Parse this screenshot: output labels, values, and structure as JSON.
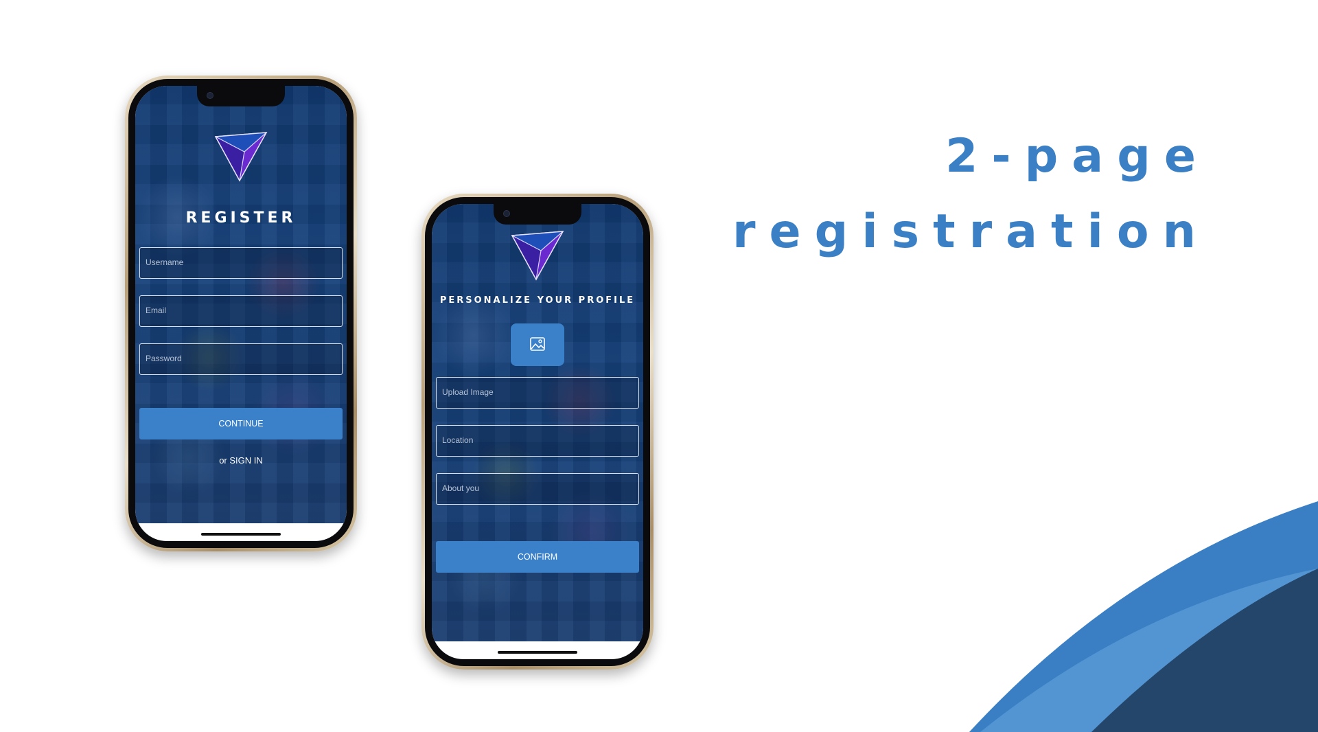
{
  "headline": {
    "line1": "2-page",
    "line2": "registration"
  },
  "colors": {
    "accent": "#3b80c4",
    "button": "#3a81c9",
    "screen_bg": "#153d76",
    "deco_dark": "#24466a",
    "deco_light": "#5396d3"
  },
  "phone1": {
    "logo_icon": "triangle-gem-logo",
    "title": "REGISTER",
    "fields": [
      {
        "placeholder": "Username"
      },
      {
        "placeholder": "Email"
      },
      {
        "placeholder": "Password"
      }
    ],
    "button_label": "CONTINUE",
    "signin_text": "or SIGN IN"
  },
  "phone2": {
    "logo_icon": "triangle-gem-logo",
    "title": "PERSONALIZE YOUR PROFILE",
    "upload_icon": "image-icon",
    "fields": [
      {
        "placeholder": "Upload Image"
      },
      {
        "placeholder": "Location"
      },
      {
        "placeholder": "About you"
      }
    ],
    "button_label": "CONFIRM"
  }
}
